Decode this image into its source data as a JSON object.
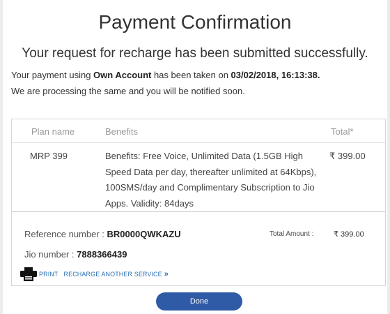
{
  "title": "Payment Confirmation",
  "subtitle": "Your request for recharge has been submitted successfully.",
  "message": {
    "line1_prefix": "Your payment using ",
    "line1_account": "Own Account",
    "line1_mid": " has been taken on ",
    "line1_datetime": "03/02/2018, 16:13:38.",
    "line2": "We are processing the same and you will be notified soon."
  },
  "table": {
    "headers": {
      "plan": "Plan name",
      "benefits": "Benefits",
      "total": "Total*"
    },
    "row": {
      "plan": "MRP 399",
      "benefits": "Benefits: Free Voice, Unlimited Data (1.5GB High Speed Data per day, thereafter unlimited at 64Kbps), 100SMS/day and Complimentary Subscription to Jio Apps. Validity: 84days",
      "total": "₹ 399.00"
    }
  },
  "summary": {
    "reference_label": "Reference number : ",
    "reference_value": "BR0000QWKAZU",
    "jio_label": "Jio number : ",
    "jio_value": "7888366439",
    "total_label": "Total Amount :",
    "total_value": "₹  399.00"
  },
  "actions": {
    "print_label": "PRINT",
    "recharge_label": "RECHARGE ANOTHER SERVICE",
    "chevron": "»",
    "print_icon": "printer-icon"
  },
  "done_label": "Done",
  "colors": {
    "link": "#2a6fb3",
    "button": "#2f5aa5"
  }
}
